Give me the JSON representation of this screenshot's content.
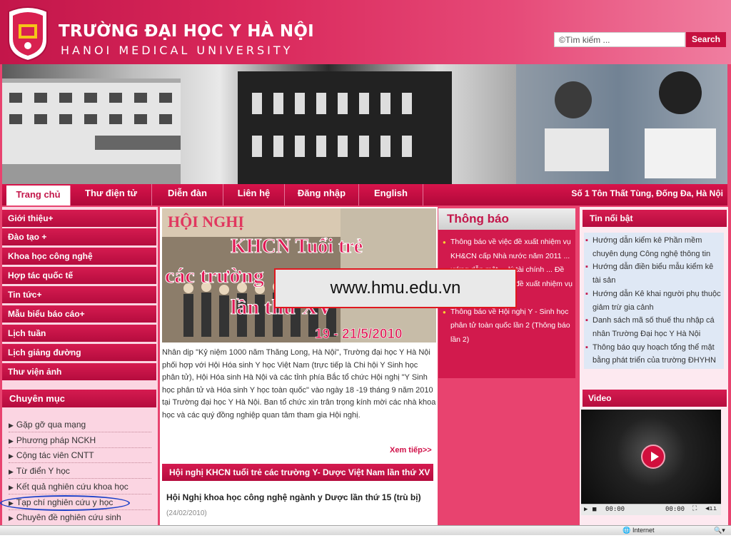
{
  "header": {
    "title_vn": "TRƯỜNG ĐẠI HỌC Y HÀ NỘI",
    "title_en": "HANOI MEDICAL UNIVERSITY",
    "search_placeholder": "Tìm kiếm ...",
    "search_button": "Search"
  },
  "nav": {
    "items": [
      "Trang chủ",
      "Thư điện tử",
      "Diễn đàn",
      "Liên hệ",
      "Đăng nhập",
      "English"
    ],
    "address": "Số 1 Tôn Thất Tùng, Đống Đa, Hà Nội"
  },
  "sidebar": {
    "menu": [
      "Giới thiệu+",
      "Đào tạo +",
      "Khoa học công nghệ",
      "Hợp tác quốc tế",
      "Tin tức+",
      "Mẫu biểu báo cáo+",
      "Lịch tuần",
      "Lịch giảng đường",
      "Thư viện ảnh"
    ],
    "category_title": "Chuyên mục",
    "categories": [
      "Gặp gỡ qua mạng",
      "Phương pháp NCKH",
      "Cộng tác viên CNTT",
      "Từ điển Y học",
      "Kết quả nghiên cứu khoa học",
      "Tạp chí nghiên cứu y học",
      "Chuyên đề nghiên cứu sinh"
    ]
  },
  "feature": {
    "img_title1": "HỘI NGHỊ",
    "img_title2": "KHCN Tuổi trẻ",
    "img_title3": "các trường",
    "img_title4": "lần thứ XV",
    "img_date": "19 - 21/5/2010",
    "text": "Nhân dịp \"Kỷ niệm 1000 năm Thăng Long, Hà Nội\", Trường đại học Y Hà Nội phối hợp với Hội Hóa sinh Y học Việt Nam (trực tiếp là Chi hội Y Sinh học phân tử), Hội Hóa sinh Hà Nội và các tỉnh phía Bắc tổ chức Hội nghị \"Y Sinh học phân tử và Hóa sinh Y học toàn quốc\" vào ngày 18 -19 tháng 9 năm 2010 tại Trường đại học Y Hà Nội. Ban tổ chức xin trân trọng kính mời các nhà khoa học và các quý đồng nghiệp quan tâm tham gia Hội nghị.",
    "more": "Xem tiếp>>"
  },
  "news": {
    "bar": "Hội nghị KHCN tuổi trẻ các trường Y- Dược Việt Nam lần thứ XV",
    "title": "Hội Nghị khoa học công nghệ ngành y Dược lần thứ 15 (trù bị)",
    "date": "(24/02/2010)"
  },
  "notice": {
    "title": "Thông báo",
    "items": [
      "Thông báo về việc đề xuất nhiệm vụ KH&CN cấp Nhà nước năm 2011 ... ướng dẫn một ... lý tài chính ... Đề cương thuyết minh đề xuất nhiệm vụ Nghị định thư",
      "Thông báo về Hội nghị Y - Sinh học phân tử toàn quốc lần 2 (Thông báo lần 2)"
    ]
  },
  "hot": {
    "title": "Tin nổi bật",
    "items": [
      "Hướng dẫn kiểm kê Phần mềm chuyên dụng Công nghệ thông tin",
      "Hướng dẫn điền biểu mẫu kiểm kê tài sản",
      "Hướng dẫn Kê khai người phụ thuộc giảm trừ gia cảnh",
      "Danh sách mã số thuế thu nhập cá nhân Trường Đại học Y Hà Nội",
      "Thông báo quy hoạch tổng thể mặt bằng phát triển của trường ĐHYHN"
    ]
  },
  "video": {
    "title": "Video",
    "time_left": "00:00",
    "time_right": "00:00"
  },
  "overlay": {
    "url": "www.hmu.edu.vn"
  },
  "status": {
    "zone": "Internet"
  }
}
